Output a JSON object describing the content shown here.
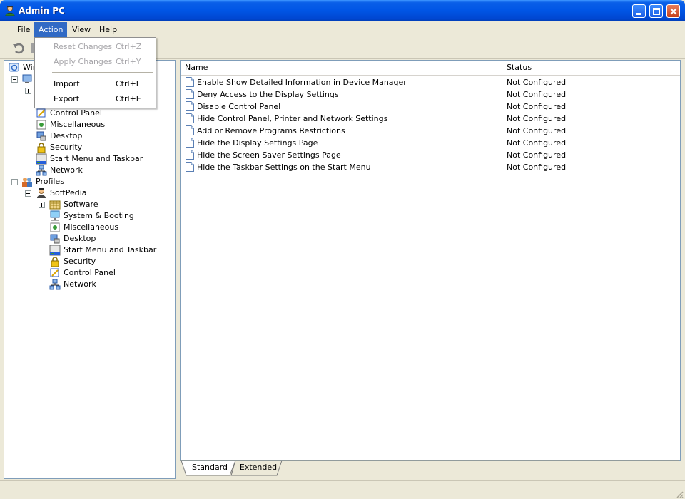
{
  "window": {
    "title": "Admin PC"
  },
  "menu": {
    "items": [
      "File",
      "Action",
      "View",
      "Help"
    ],
    "active": "Action"
  },
  "action_menu": {
    "items": [
      {
        "label": "Reset Changes",
        "shortcut": "Ctrl+Z",
        "enabled": false
      },
      {
        "label": "Apply Changes",
        "shortcut": "Ctrl+Y",
        "enabled": false
      },
      {
        "label": "Import",
        "shortcut": "Ctrl+I",
        "enabled": true
      },
      {
        "label": "Export",
        "shortcut": "Ctrl+E",
        "enabled": true
      }
    ]
  },
  "toolbar": {
    "icons": [
      "undo-icon",
      "apply-icon"
    ]
  },
  "tree": {
    "root": "Wir",
    "windows_sections": [
      "Control Panel",
      "Miscellaneous",
      "Desktop",
      "Security",
      "Start Menu and Taskbar",
      "Network"
    ],
    "profiles_label": "Profiles",
    "profile_name": "SoftPedia",
    "profile_sections": [
      "Software",
      "System & Booting",
      "Miscellaneous",
      "Desktop",
      "Start Menu and Taskbar",
      "Security",
      "Control Panel",
      "Network"
    ]
  },
  "list": {
    "columns": [
      "Name",
      "Status"
    ],
    "rows": [
      {
        "name": "Enable Show Detailed Information in Device Manager",
        "status": "Not Configured"
      },
      {
        "name": "Deny Access to the Display Settings",
        "status": "Not Configured"
      },
      {
        "name": "Disable Control Panel",
        "status": "Not Configured"
      },
      {
        "name": "Hide Control Panel, Printer and Network Settings",
        "status": "Not Configured"
      },
      {
        "name": "Add or Remove Programs Restrictions",
        "status": "Not Configured"
      },
      {
        "name": "Hide the Display Settings Page",
        "status": "Not Configured"
      },
      {
        "name": "Hide the Screen Saver Settings Page",
        "status": "Not Configured"
      },
      {
        "name": "Hide the Taskbar Settings on the Start Menu",
        "status": "Not Configured"
      }
    ]
  },
  "tabs": [
    "Standard",
    "Extended"
  ],
  "colors": {
    "titlebar": "#0055e5",
    "menu_highlight": "#316ac5",
    "window_bg": "#ece9d8"
  }
}
